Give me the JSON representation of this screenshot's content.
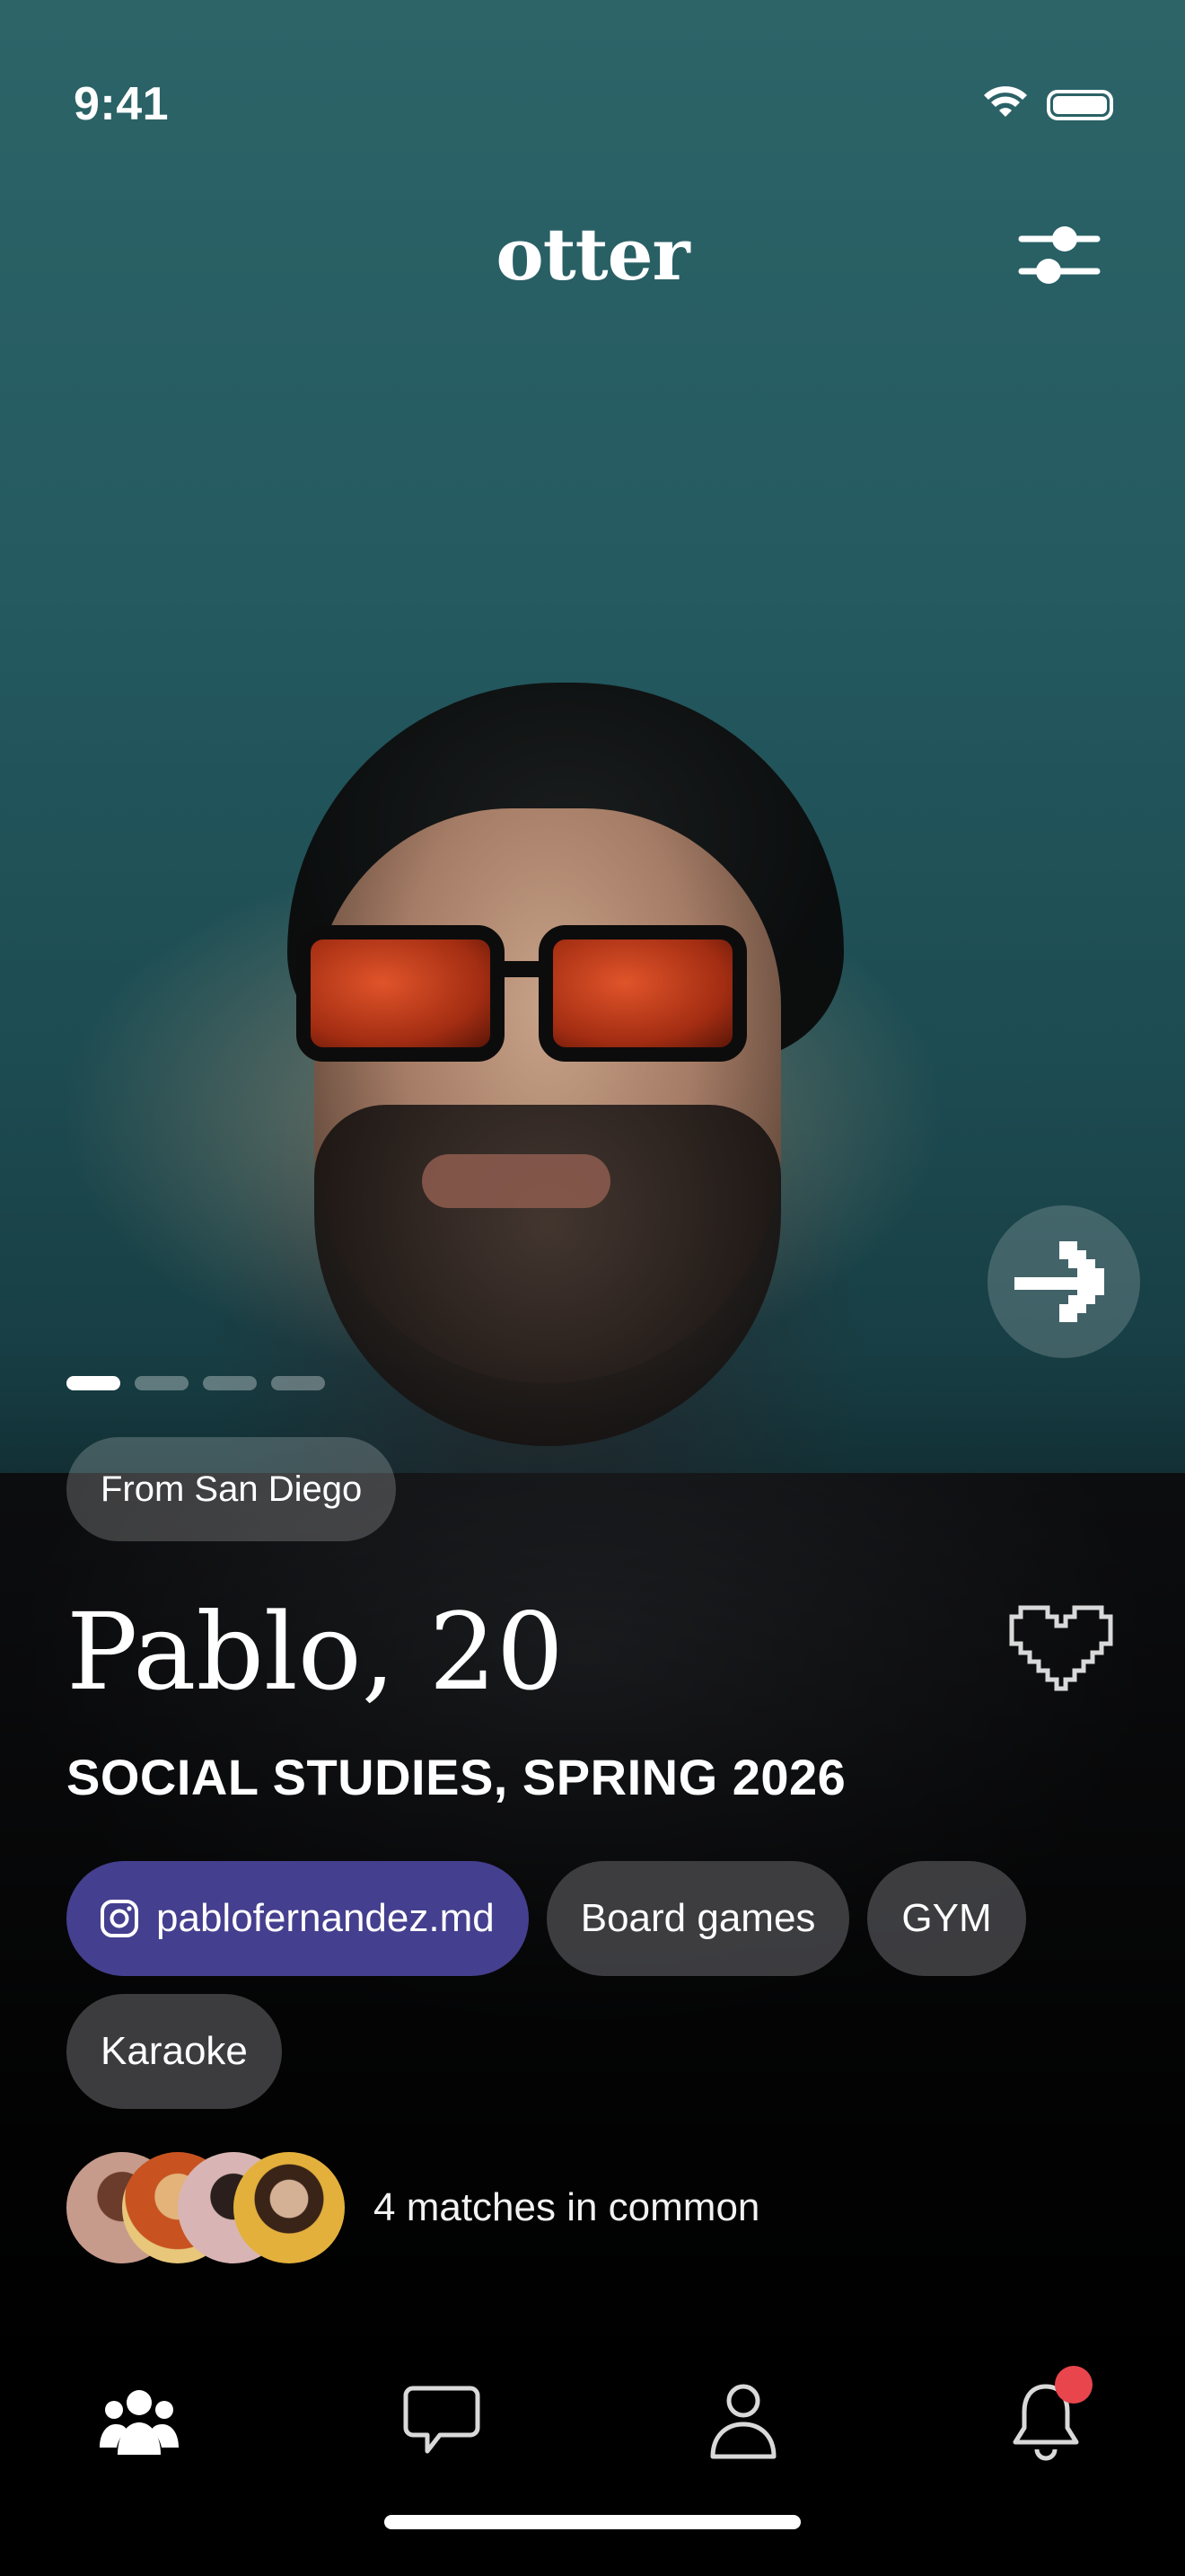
{
  "status_bar": {
    "time": "9:41"
  },
  "header": {
    "logo": "otter"
  },
  "profile": {
    "location": "From San Diego",
    "name_age": "Pablo, 20",
    "program": "SOCIAL STUDIES, SPRING 2026",
    "photo_count": 4,
    "active_photo": 1,
    "chips": [
      {
        "label": "pablofernandez.md",
        "type": "instagram"
      },
      {
        "label": "Board games"
      },
      {
        "label": "GYM"
      },
      {
        "label": "Karaoke"
      }
    ],
    "matches_label": "4 matches in common"
  },
  "tabbar": {
    "items": [
      {
        "icon": "people-icon",
        "active": true
      },
      {
        "icon": "chat-bubble-icon",
        "active": false
      },
      {
        "icon": "profile-icon",
        "active": false
      },
      {
        "icon": "bell-icon",
        "active": false,
        "has_notification": true
      }
    ]
  },
  "colors": {
    "instagram_chip": "#453f8f",
    "notification_dot": "#e8454d",
    "chip_bg": "#46464a"
  }
}
